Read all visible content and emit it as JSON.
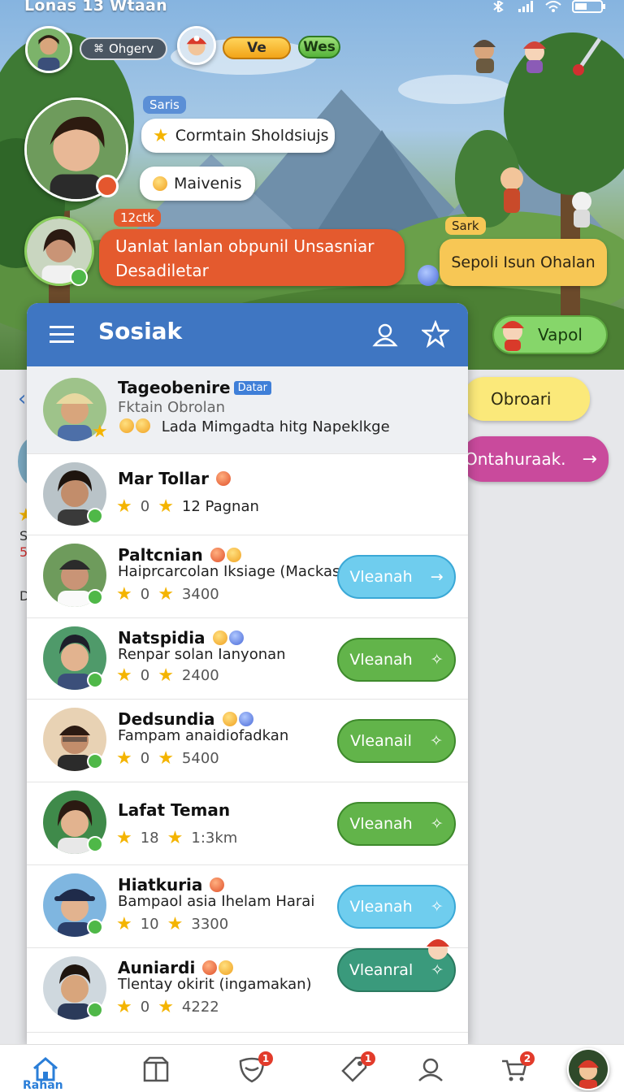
{
  "status_bar": {
    "time": "Lonas 13 Wtaan"
  },
  "hud": {
    "status_label": "Ohgerv",
    "yellow_pill": "Ve",
    "green_pill": "Wes"
  },
  "chat": {
    "name_tag_1": "Saris",
    "bubble_1": "Cormtain Sholdsiujs",
    "bubble_2": "Maivenis",
    "name_tag_2": "12ctk",
    "orange_message": "Uanlat lanlan obpunil Unsasniar Desadiletar",
    "name_tag_3": "Sark",
    "yellow_message": "Sepoli Isun Ohalan"
  },
  "side_buttons": {
    "vapol": "Vapol",
    "obroari": "Obroari",
    "ontah": "Ontahuraak."
  },
  "left_peek": {
    "s": "S",
    "five": "5",
    "d": "D"
  },
  "panel": {
    "title": "Sosiak",
    "rows": [
      {
        "name": "Tageobenire",
        "badge": "Datar",
        "line1": "Fktain Obrolan",
        "line2": "Lada Mimgadta hitg Napeklkge"
      },
      {
        "name": "Mar Tollar",
        "stat1": "0",
        "stat2": "12 Pagnan"
      },
      {
        "name": "Paltcnian",
        "sub": "Haiprcarcolan Iksiage (Mackas)",
        "stat1": "0",
        "stat2": "3400",
        "button": "Vleanah"
      },
      {
        "name": "Natspidia",
        "sub": "Renpar solan Ianyonan",
        "stat1": "0",
        "stat2": "2400",
        "button": "Vleanah"
      },
      {
        "name": "Dedsundia",
        "sub": "Fampam anaidiofadkan",
        "stat1": "0",
        "stat2": "5400",
        "button": "Vleanail"
      },
      {
        "name": "Lafat Teman",
        "stat1": "18",
        "stat2": "1:3km",
        "button": "Vleanah"
      },
      {
        "name": "Hiatkuria",
        "sub": "Bampaol asia Ihelam Harai",
        "stat1": "10",
        "stat2": "3300",
        "button": "Vleanah"
      },
      {
        "name": "Auniardi",
        "sub": "Tlentay okirit (ingamakan)",
        "stat1": "0",
        "stat2": "4222",
        "button": "Vleanral"
      }
    ]
  },
  "bottom_nav": {
    "home_label": "Rahan",
    "badges": {
      "shield": "1",
      "tag": "1",
      "cart": "2"
    }
  },
  "colors": {
    "panel_header": "#3f76c2",
    "button_green": "#62b44a",
    "button_light": "#6fcdee",
    "button_teal": "#3a9a7c",
    "orange_bubble": "#e45a2e",
    "accent_pink": "#c94a9c"
  }
}
